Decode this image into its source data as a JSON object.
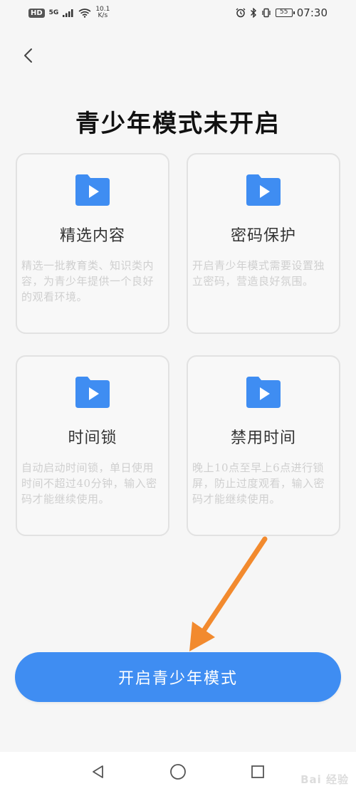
{
  "status_bar": {
    "hd": "HD",
    "signal": "5G",
    "speed_value": "10.1",
    "speed_unit": "K/s",
    "battery": "55",
    "time": "07:30"
  },
  "header": {
    "title": "青少年模式未开启"
  },
  "cards": [
    {
      "title": "精选内容",
      "description": "精选一批教育类、知识类内容，为青少年提供一个良好的观看环境。",
      "icon": "folder-play-icon"
    },
    {
      "title": "密码保护",
      "description": "开启青少年模式需要设置独立密码，营造良好氛围。",
      "icon": "folder-play-icon"
    },
    {
      "title": "时间锁",
      "description": "自动启动时间锁，单日使用时间不超过40分钟，输入密码才能继续使用。",
      "icon": "folder-play-icon"
    },
    {
      "title": "禁用时间",
      "description": "晚上10点至早上6点进行锁屏，防止过度观看，输入密码才能继续使用。",
      "icon": "folder-play-icon"
    }
  ],
  "cta": {
    "label": "开启青少年模式"
  },
  "colors": {
    "accent": "#3f8df2",
    "arrow": "#f28a2e",
    "background": "#f6f6f6"
  },
  "nav": {
    "items": [
      "back-triangle-icon",
      "home-circle-icon",
      "recents-square-icon"
    ]
  },
  "watermark": {
    "text": "Bai 经验"
  }
}
